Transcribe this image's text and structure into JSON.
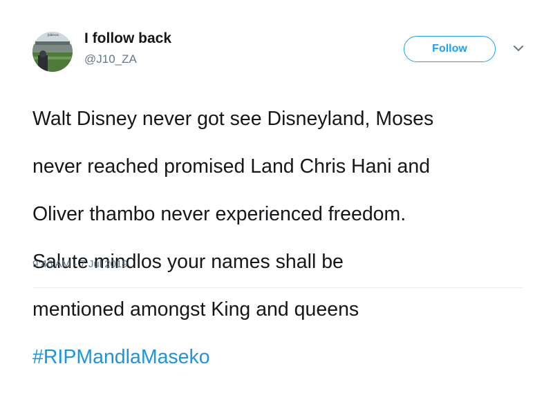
{
  "user": {
    "display_name": "I follow back",
    "handle": "@J10_ZA",
    "avatar_label": "Joblesss"
  },
  "actions": {
    "follow_label": "Follow",
    "more_icon": "chevron-down-icon"
  },
  "tweet": {
    "lines": [
      "Walt Disney never got see Disneyland, Moses",
      "never reached promised Land Chris Hani and",
      "Oliver thambo never experienced freedom.",
      "Salute mindlos your names shall be",
      "mentioned amongst King and queens"
    ],
    "hashtag": "#RIPMandlaMaseko"
  },
  "meta": {
    "timestamp": "9:46 AM - 7 Jul 2019"
  },
  "colors": {
    "accent": "#1da1f2",
    "hashtag": "#1b95e0",
    "secondary_text": "#657786",
    "primary_text": "#14171a"
  }
}
